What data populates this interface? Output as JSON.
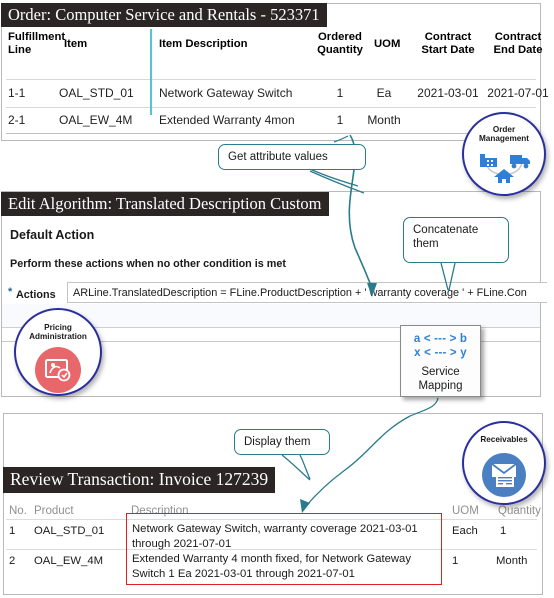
{
  "panels": {
    "order": {
      "title": "Order: Computer Service and Rentals - 523371",
      "columns": [
        "Fulfillment Line",
        "Item",
        "Item Description",
        "Ordered Quantity",
        "UOM",
        "Contract Start Date",
        "Contract End Date"
      ],
      "columns_wrapped": {
        "fulfillment_line_1": "Fulfillment",
        "fulfillment_line_2": "Line",
        "item": "Item",
        "item_description": "Item Description",
        "ordered_1": "Ordered",
        "ordered_2": "Quantity",
        "uom": "UOM",
        "contract_start_1": "Contract",
        "contract_start_2": "Start Date",
        "contract_end_1": "Contract",
        "contract_end_2": "End Date"
      },
      "rows": [
        {
          "fulfillment_line": "1-1",
          "item": "OAL_STD_01",
          "item_description": "Network Gateway Switch",
          "ordered_quantity": "1",
          "uom": "Ea",
          "contract_start_date": "2021-03-01",
          "contract_end_date": "2021-07-01"
        },
        {
          "fulfillment_line": "2-1",
          "item": "OAL_EW_4M",
          "item_description": "Extended Warranty 4mon",
          "ordered_quantity": "1",
          "uom": "Month",
          "contract_start_date": "",
          "contract_end_date": ""
        }
      ]
    },
    "algorithm": {
      "title": "Edit Algorithm: Translated Description Custom",
      "default_action_heading": "Default Action",
      "perform_text": "Perform these actions when no other condition is met",
      "required_marker": "*",
      "actions_label": "Actions",
      "actions_value": "ARLine.TranslatedDescription = FLine.ProductDescription + ' warranty coverage ' + FLine.Con"
    },
    "invoice": {
      "title": "Review Transaction: Invoice 127239",
      "columns": [
        "No.",
        "Product",
        "Description",
        "UOM",
        "Quantity"
      ],
      "rows": [
        {
          "no": "1",
          "product": "OAL_STD_01",
          "description": "Network Gateway Switch, warranty coverage  2021-03-01 through  2021-07-01",
          "uom": "Each",
          "quantity": "1"
        },
        {
          "no": "2",
          "product": "OAL_EW_4M",
          "description": "Extended Warranty 4 month fixed, for Network  Gateway Switch 1 Ea 2021-03-01  through  2021-07-01",
          "uom": "1",
          "quantity": "Month"
        }
      ]
    }
  },
  "callouts": {
    "get_attribute_values": "Get attribute values",
    "concatenate_them": "Concatenate\nthem",
    "display_them": "Display them"
  },
  "process_icons": {
    "order_management": {
      "label": "Order\nManagement",
      "icon": "factory-truck-home-icon"
    },
    "pricing_administration": {
      "label": "Pricing\nAdministration",
      "icon": "pricing-tag-icon"
    },
    "receivables": {
      "label": "Receivables",
      "icon": "envelope-invoice-icon"
    }
  },
  "service_mapping": {
    "line_1": "a < --- > b",
    "line_2": "x < --- > y",
    "title_1": "Service",
    "title_2": "Mapping"
  },
  "colors": {
    "title_bar_bg": "#2b2523",
    "callout_border": "#2b7b8c",
    "connector": "#2b7b8c",
    "invoice_highlight": "#e02020",
    "icon_ring": "#2a2f9e",
    "pricing_disc": "#e8676b",
    "receivables_disc": "#4a7fc1",
    "service_mapping_text": "#2f7fd6",
    "cyan_divider": "#54c5d0"
  }
}
